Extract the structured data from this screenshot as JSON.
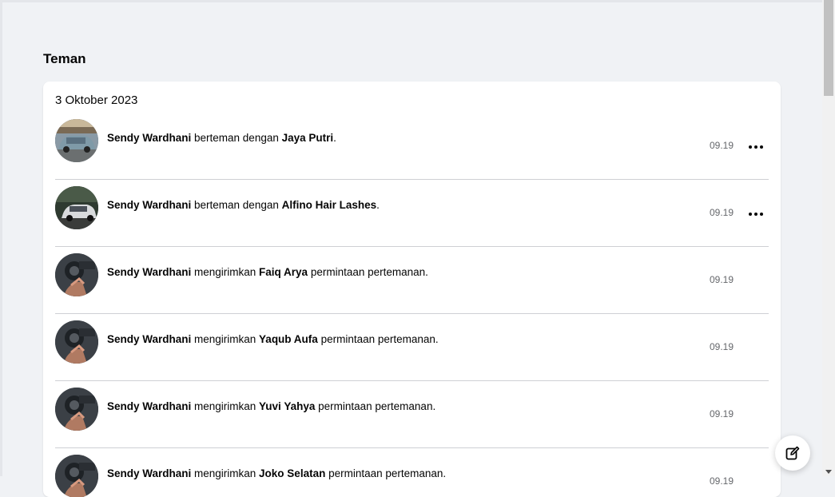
{
  "page": {
    "title": "Teman"
  },
  "card": {
    "date": "3 Oktober 2023",
    "rows": [
      {
        "actor": "Sendy Wardhani",
        "verb": " berteman dengan ",
        "target": "Jaya Putri",
        "suffix": ".",
        "time": "09.19",
        "has_menu": true,
        "avatar": "car-photo"
      },
      {
        "actor": "Sendy Wardhani",
        "verb": " berteman dengan ",
        "target": "Alfino Hair Lashes",
        "suffix": ".",
        "time": "09.19",
        "has_menu": true,
        "avatar": "car-dark-photo"
      },
      {
        "actor": "Sendy Wardhani",
        "verb": " mengirimkan ",
        "target": "Faiq Arya",
        "suffix": " permintaan pertemanan.",
        "time": "09.19",
        "has_menu": false,
        "avatar": "bike-photo"
      },
      {
        "actor": "Sendy Wardhani",
        "verb": " mengirimkan ",
        "target": "Yaqub Aufa",
        "suffix": " permintaan pertemanan.",
        "time": "09.19",
        "has_menu": false,
        "avatar": "bike-photo"
      },
      {
        "actor": "Sendy Wardhani",
        "verb": " mengirimkan ",
        "target": "Yuvi Yahya",
        "suffix": " permintaan pertemanan.",
        "time": "09.19",
        "has_menu": false,
        "avatar": "bike-photo"
      },
      {
        "actor": "Sendy Wardhani",
        "verb": " mengirimkan ",
        "target": "Joko Selatan",
        "suffix": " permintaan pertemanan.",
        "time": "09.19",
        "has_menu": false,
        "avatar": "bike-photo"
      }
    ]
  },
  "icons": {
    "more": "more-horizontal-icon",
    "compose": "compose-edit-icon"
  },
  "colors": {
    "background": "#f0f2f5",
    "card": "#ffffff",
    "secondary_text": "#65676b"
  }
}
